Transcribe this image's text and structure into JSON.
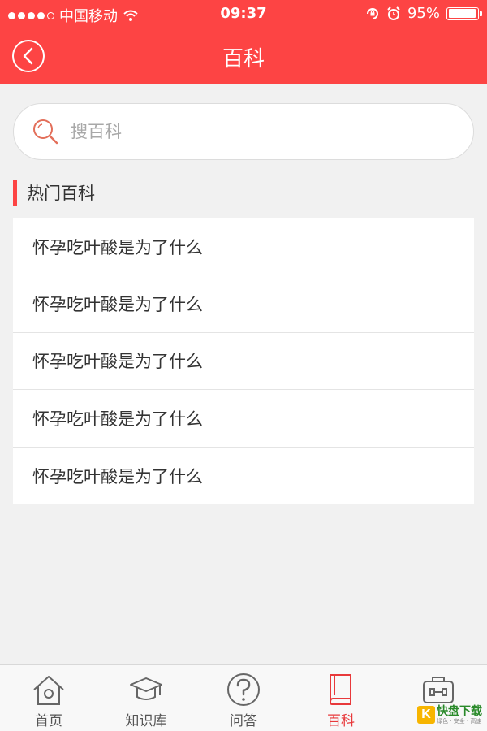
{
  "status_bar": {
    "carrier": "中国移动",
    "time": "09:37",
    "battery": "95%",
    "battery_level": 0.95,
    "signal_bars_filled": 4,
    "signal_bars_total": 5
  },
  "navbar": {
    "title": "百科",
    "back_icon": "chevron-left-circle-icon"
  },
  "search": {
    "placeholder": "搜百科",
    "value": ""
  },
  "section": {
    "title": "热门百科"
  },
  "list": {
    "items": [
      {
        "label": "怀孕吃叶酸是为了什么"
      },
      {
        "label": "怀孕吃叶酸是为了什么"
      },
      {
        "label": "怀孕吃叶酸是为了什么"
      },
      {
        "label": "怀孕吃叶酸是为了什么"
      },
      {
        "label": "怀孕吃叶酸是为了什么"
      }
    ]
  },
  "tabbar": {
    "tabs": [
      {
        "label": "首页",
        "icon": "home-icon",
        "active": false
      },
      {
        "label": "知识库",
        "icon": "graduation-cap-icon",
        "active": false
      },
      {
        "label": "问答",
        "icon": "question-icon",
        "active": false
      },
      {
        "label": "百科",
        "icon": "book-icon",
        "active": true
      },
      {
        "label": "",
        "icon": "toolbox-icon",
        "active": false
      }
    ]
  },
  "watermark": {
    "letter": "K",
    "main": "快盘下载",
    "sub": "绿色 · 安全 · 高速"
  },
  "colors": {
    "brand": "#fd4444",
    "active_tab": "#e8393b",
    "background": "#f1f1f1"
  }
}
